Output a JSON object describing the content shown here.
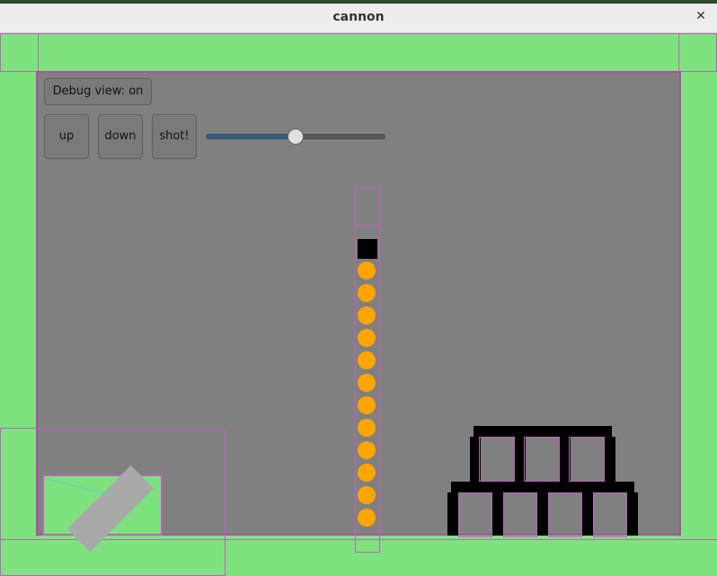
{
  "window": {
    "title": "cannon",
    "close_icon": "close-icon"
  },
  "controls": {
    "debug_label": "Debug view: on",
    "up_label": "up",
    "down_label": "down",
    "shot_label": "shot!",
    "power_slider_value": 0.5
  },
  "colors": {
    "ground": "#7ee37e",
    "play_area": "#808080",
    "ball": "#ffa500",
    "block": "#000000",
    "debug_outline": "#c060c0",
    "slider_fill": "#2b5f8c"
  },
  "scene": {
    "ball_count": 12
  }
}
